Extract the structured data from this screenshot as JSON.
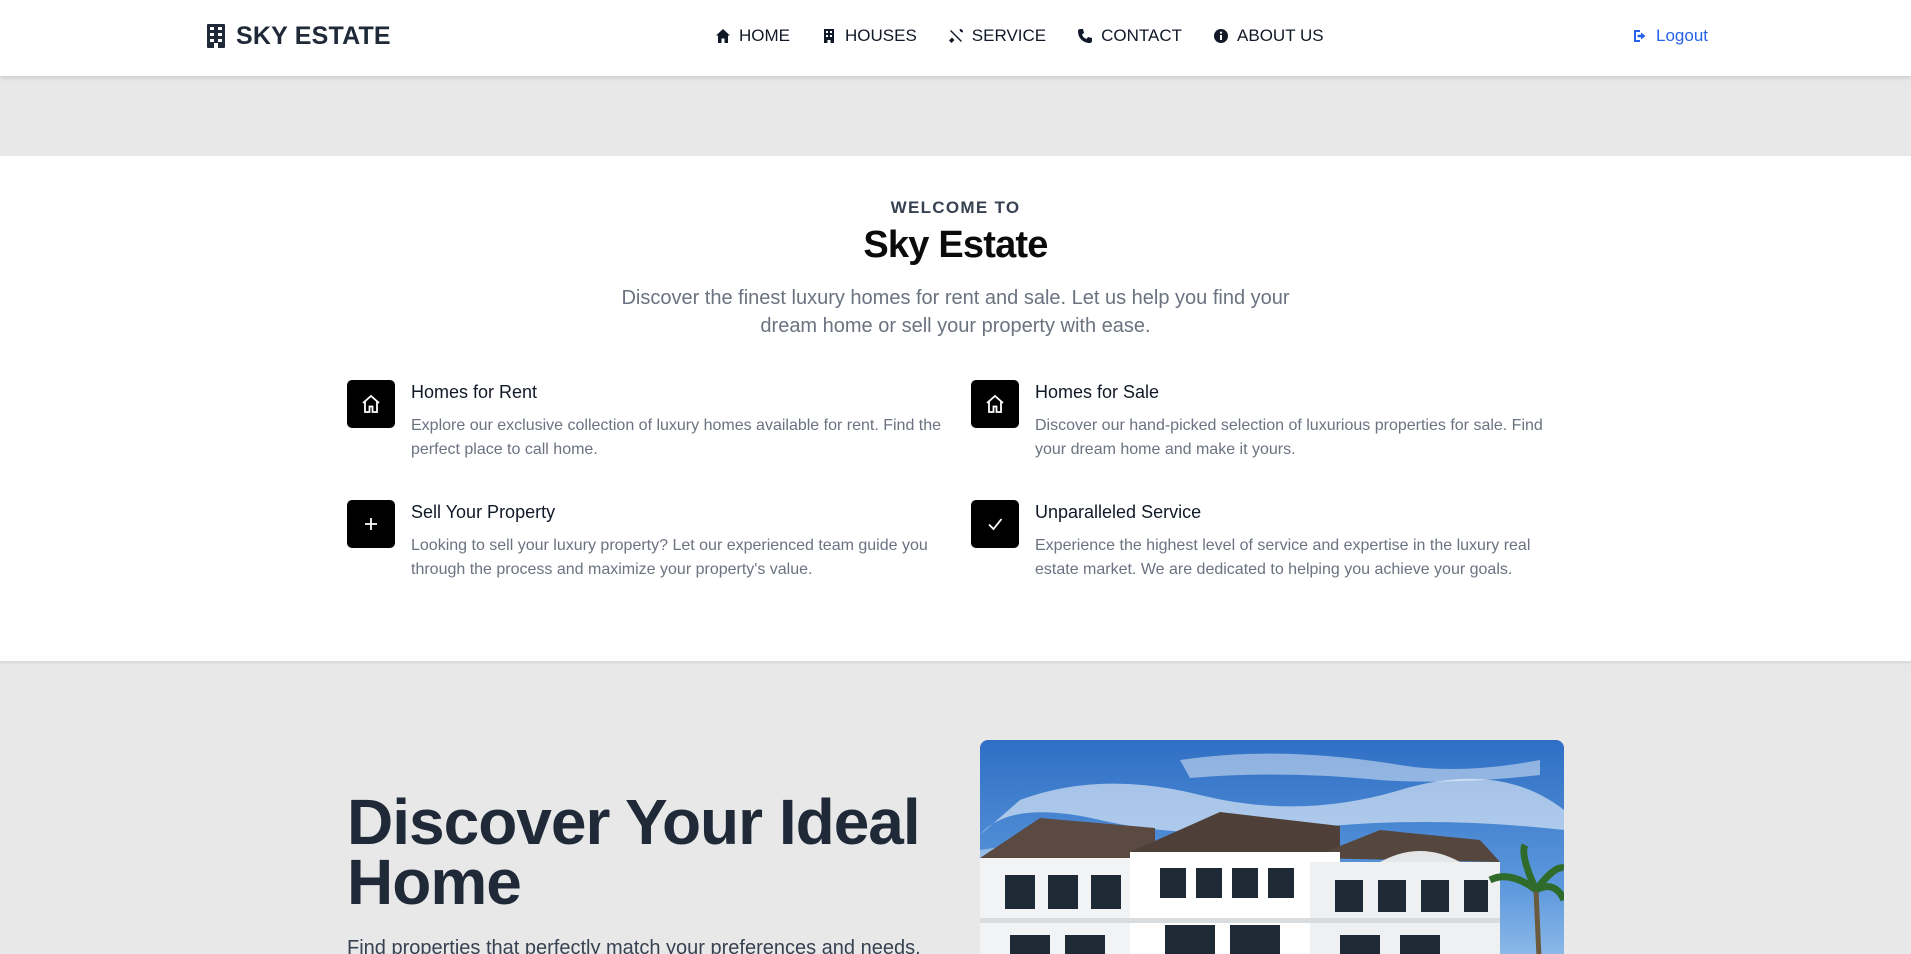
{
  "brand": {
    "name": "SKY ESTATE",
    "icon": "building-icon"
  },
  "nav": {
    "items": [
      {
        "label": "HOME",
        "icon": "home-icon"
      },
      {
        "label": "HOUSES",
        "icon": "building-icon"
      },
      {
        "label": "SERVICE",
        "icon": "tools-icon"
      },
      {
        "label": "CONTACT",
        "icon": "phone-icon"
      },
      {
        "label": "ABOUT US",
        "icon": "info-icon"
      }
    ],
    "logout_label": "Logout"
  },
  "welcome": {
    "eyebrow": "WELCOME TO",
    "title": "Sky Estate",
    "subtitle": "Discover the finest luxury homes for rent and sale. Let us help you find your dream home or sell your property with ease.",
    "features": [
      {
        "title": "Homes for Rent",
        "desc": "Explore our exclusive collection of luxury homes available for rent. Find the perfect place to call home.",
        "icon": "home-outline-icon"
      },
      {
        "title": "Homes for Sale",
        "desc": "Discover our hand-picked selection of luxurious properties for sale. Find your dream home and make it yours.",
        "icon": "home-outline-icon"
      },
      {
        "title": "Sell Your Property",
        "desc": "Looking to sell your luxury property? Let our experienced team guide you through the process and maximize your property's value.",
        "icon": "plus-icon"
      },
      {
        "title": "Unparalleled Service",
        "desc": "Experience the highest level of service and expertise in the luxury real estate market. We are dedicated to helping you achieve your goals.",
        "icon": "check-icon"
      }
    ]
  },
  "hero": {
    "title": "Discover Your Ideal Home",
    "text": "Find properties that perfectly match your preferences and needs."
  },
  "colors": {
    "accent": "#2563eb",
    "text": "#111827",
    "muted": "#6b7280",
    "band": "#e8e8e8"
  }
}
